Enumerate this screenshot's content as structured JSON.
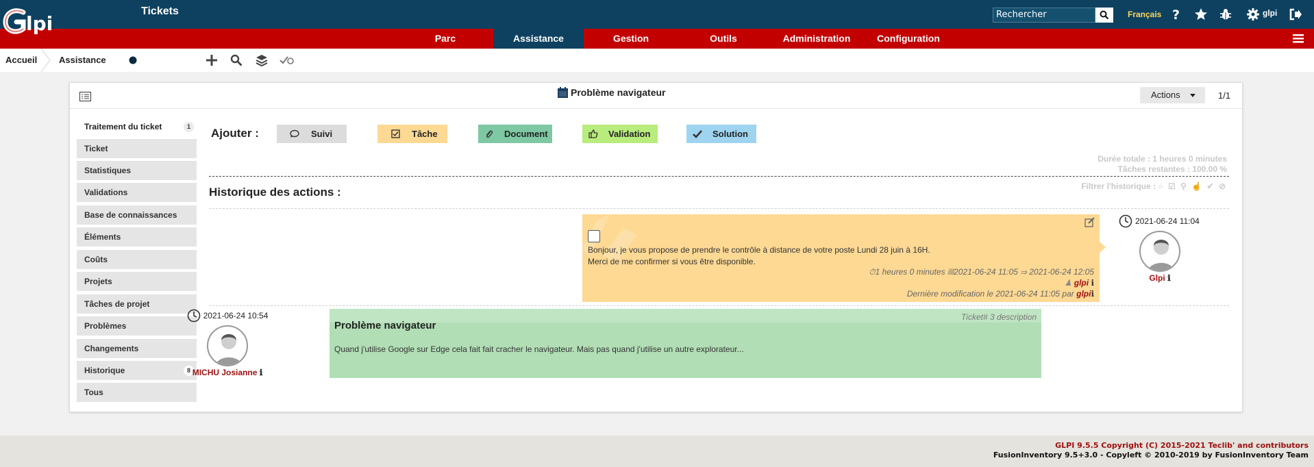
{
  "header": {
    "logo_text": "Glpi",
    "search_placeholder": "Rechercher",
    "language": "Français",
    "user": "glpi",
    "icons": [
      "search-icon",
      "help-icon",
      "star-icon",
      "bug-icon",
      "gear-icon",
      "logout-icon"
    ]
  },
  "menu": {
    "items": [
      {
        "label": "Parc"
      },
      {
        "label": "Assistance",
        "active": true
      },
      {
        "label": "Gestion"
      },
      {
        "label": "Outils"
      },
      {
        "label": "Administration"
      },
      {
        "label": "Configuration"
      }
    ]
  },
  "breadcrumb": {
    "home": "Accueil",
    "section": "Assistance",
    "current": "Tickets",
    "icons": [
      "plus-icon",
      "search-icon",
      "layers-icon",
      "check-eye-icon"
    ]
  },
  "panel": {
    "title": "Problème navigateur",
    "actions_label": "Actions",
    "pager": "1/1"
  },
  "tabs": [
    {
      "label": "Traitement du ticket",
      "badge": "1",
      "active": true
    },
    {
      "label": "Ticket"
    },
    {
      "label": "Statistiques"
    },
    {
      "label": "Validations"
    },
    {
      "label": "Base de connaissances"
    },
    {
      "label": "Éléments"
    },
    {
      "label": "Coûts"
    },
    {
      "label": "Projets"
    },
    {
      "label": "Tâches de projet"
    },
    {
      "label": "Problèmes"
    },
    {
      "label": "Changements"
    },
    {
      "label": "Historique",
      "badge": "8"
    },
    {
      "label": "Tous"
    }
  ],
  "add_bar": {
    "label": "Ajouter :",
    "buttons": [
      {
        "label": "Suivi",
        "color": "#dcdcdc",
        "icon": "comment-icon"
      },
      {
        "label": "Tâche",
        "color": "#fdd994",
        "icon": "checkbox-icon"
      },
      {
        "label": "Document",
        "color": "#7ec8a3",
        "icon": "paperclip-icon"
      },
      {
        "label": "Validation",
        "color": "#b8ec7c",
        "icon": "thumbs-up-icon"
      },
      {
        "label": "Solution",
        "color": "#9fd4f0",
        "icon": "check-icon"
      }
    ]
  },
  "stats": {
    "total": "Durée totale : 1 heures 0 minutes",
    "remaining": "Tâches restantes : 100.00 %",
    "filter": "Filtrer l'historique :"
  },
  "history_title": "Historique des actions :",
  "task": {
    "line1": "Bonjour, je vous propose de prendre le contrôle à distance de votre poste Lundi 28 juin à 16H.",
    "line2": "Merci de me confirmer si vous être disponible.",
    "duration": "1 heures 0 minutes",
    "period": "2021-06-24 11:05 ⇒ 2021-06-24 12:05",
    "user": "glpi",
    "modified_prefix": "Dernière modification le 2021-06-24 11:05 par",
    "modified_user": "glpi",
    "actor_date": "2021-06-24 11:04",
    "actor_name": "Glpi"
  },
  "description": {
    "actor_date": "2021-06-24 10:54",
    "actor_name": "MICHU Josianne",
    "title": "Problème navigateur",
    "ref": "Ticket# 3 description",
    "text": "Quand j'utilise Google sur Edge cela fait fait cracher le navigateur. Mais pas quand j'utilise un autre explorateur..."
  },
  "footer": {
    "line1": "GLPI 9.5.5 Copyright (C) 2015-2021 Teclib' and contributors",
    "line2": "FusionInventory 9.5+3.0 - Copyleft © 2010-2019 by FusionInventory Team"
  },
  "colors": {
    "navy": "#0e4160",
    "red": "#c30000",
    "task": "#fdd994",
    "description": "#b1deb5"
  }
}
